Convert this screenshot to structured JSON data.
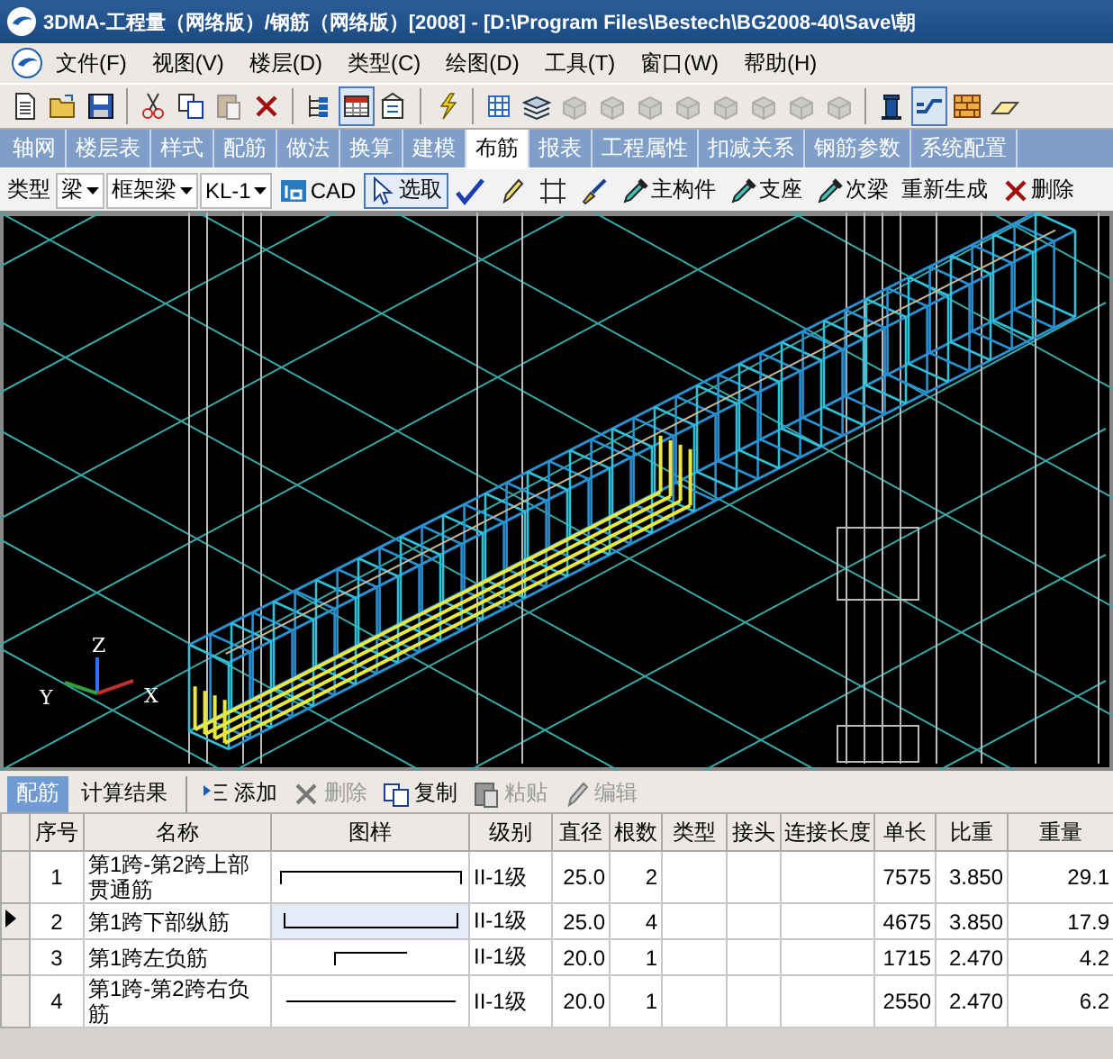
{
  "window": {
    "title": "3DMA-工程量（网络版）/钢筋（网络版）[2008] - [D:\\Program Files\\Bestech\\BG2008-40\\Save\\朝"
  },
  "menu": [
    "文件(F)",
    "视图(V)",
    "楼层(D)",
    "类型(C)",
    "绘图(D)",
    "工具(T)",
    "窗口(W)",
    "帮助(H)"
  ],
  "toolbar": [
    {
      "kind": "new",
      "disabled": false,
      "pressed": false
    },
    {
      "kind": "open",
      "disabled": false,
      "pressed": false
    },
    {
      "kind": "save",
      "disabled": false,
      "pressed": false
    },
    {
      "kind": "separator"
    },
    {
      "kind": "cut",
      "disabled": false,
      "pressed": false
    },
    {
      "kind": "copy",
      "disabled": false,
      "pressed": false
    },
    {
      "kind": "paste",
      "disabled": true,
      "pressed": false
    },
    {
      "kind": "delete",
      "disabled": false,
      "pressed": false
    },
    {
      "kind": "separator"
    },
    {
      "kind": "tree",
      "disabled": false,
      "pressed": false
    },
    {
      "kind": "table",
      "disabled": false,
      "pressed": true
    },
    {
      "kind": "form",
      "disabled": false,
      "pressed": false
    },
    {
      "kind": "separator"
    },
    {
      "kind": "lightning",
      "disabled": false,
      "pressed": false
    },
    {
      "kind": "separator"
    },
    {
      "kind": "grid",
      "disabled": false,
      "pressed": false
    },
    {
      "kind": "layers",
      "disabled": false,
      "pressed": false
    },
    {
      "kind": "block",
      "disabled": true,
      "pressed": false
    },
    {
      "kind": "block",
      "disabled": true,
      "pressed": false
    },
    {
      "kind": "block",
      "disabled": true,
      "pressed": false
    },
    {
      "kind": "block",
      "disabled": true,
      "pressed": false
    },
    {
      "kind": "block",
      "disabled": true,
      "pressed": false
    },
    {
      "kind": "block",
      "disabled": true,
      "pressed": false
    },
    {
      "kind": "block",
      "disabled": true,
      "pressed": false
    },
    {
      "kind": "block",
      "disabled": true,
      "pressed": false
    },
    {
      "kind": "separator"
    },
    {
      "kind": "column",
      "disabled": false,
      "pressed": false
    },
    {
      "kind": "bent-bar",
      "disabled": false,
      "pressed": true
    },
    {
      "kind": "brick",
      "disabled": false,
      "pressed": false
    },
    {
      "kind": "eraser",
      "disabled": false,
      "pressed": false
    }
  ],
  "tabs": [
    {
      "label": "轴网",
      "selected": false
    },
    {
      "label": "楼层表",
      "selected": false
    },
    {
      "label": "样式",
      "selected": false
    },
    {
      "label": "配筋",
      "selected": false
    },
    {
      "label": "做法",
      "selected": false
    },
    {
      "label": "换算",
      "selected": false
    },
    {
      "label": "建模",
      "selected": false
    },
    {
      "label": "布筋",
      "selected": true
    },
    {
      "label": "报表",
      "selected": false
    },
    {
      "label": "工程属性",
      "selected": false
    },
    {
      "label": "扣减关系",
      "selected": false
    },
    {
      "label": "钢筋参数",
      "selected": false
    },
    {
      "label": "系统配置",
      "selected": false
    }
  ],
  "edit_toolbar": [
    {
      "kind": "label",
      "text": "类型"
    },
    {
      "kind": "dropdown",
      "text": "梁"
    },
    {
      "kind": "dropdown",
      "text": "框架梁"
    },
    {
      "kind": "dropdown",
      "text": "KL-1"
    },
    {
      "kind": "cad",
      "text": "CAD",
      "pressed": false
    },
    {
      "kind": "pointer",
      "text": "选取",
      "pressed": true
    },
    {
      "kind": "check",
      "pressed": false
    },
    {
      "kind": "pen",
      "pressed": false
    },
    {
      "kind": "frame",
      "pressed": false
    },
    {
      "kind": "brush",
      "pressed": false
    },
    {
      "kind": "dropper",
      "text": "主构件",
      "pressed": false
    },
    {
      "kind": "dropper",
      "text": "支座",
      "pressed": false
    },
    {
      "kind": "dropper",
      "text": "次梁",
      "pressed": false
    },
    {
      "kind": "plain",
      "text": "重新生成",
      "pressed": false
    },
    {
      "kind": "delete",
      "text": "删除",
      "pressed": false
    }
  ],
  "view": {
    "axis_labels": [
      "Z",
      "Y",
      "X"
    ]
  },
  "panel_tabs": [
    {
      "label": "配筋",
      "selected": true
    },
    {
      "label": "计算结果",
      "selected": false
    }
  ],
  "panel_actions": [
    {
      "kind": "add",
      "label": "添加",
      "disabled": false
    },
    {
      "kind": "delete",
      "label": "删除",
      "disabled": true
    },
    {
      "kind": "copy",
      "label": "复制",
      "disabled": false
    },
    {
      "kind": "paste",
      "label": "粘贴",
      "disabled": true
    },
    {
      "kind": "edit",
      "label": "编辑",
      "disabled": true
    }
  ],
  "table": {
    "columns": [
      "序号",
      "名称",
      "图样",
      "级别",
      "直径",
      "根数",
      "类型",
      "接头",
      "连接长度",
      "单长",
      "比重",
      "重量"
    ],
    "rows": [
      {
        "index": "1",
        "name": "第1跨-第2跨上部贯通筋",
        "kind": "top-bar",
        "grade": "II-1级",
        "diameter": "25.0",
        "count": "2",
        "unit_length": "7575",
        "density": "3.850",
        "weight": "29.1",
        "selected": false
      },
      {
        "index": "2",
        "name": "第1跨下部纵筋",
        "kind": "bottom-bar",
        "grade": "II-1级",
        "diameter": "25.0",
        "count": "4",
        "unit_length": "4675",
        "density": "3.850",
        "weight": "17.9",
        "selected": true
      },
      {
        "index": "3",
        "name": "第1跨左负筋",
        "kind": "hook-bar",
        "grade": "II-1级",
        "diameter": "20.0",
        "count": "1",
        "unit_length": "1715",
        "density": "2.470",
        "weight": "4.2",
        "selected": false
      },
      {
        "index": "4",
        "name": "第1跨-第2跨右负筋",
        "kind": "straight-bar",
        "grade": "II-1级",
        "diameter": "20.0",
        "count": "1",
        "unit_length": "2550",
        "density": "2.470",
        "weight": "6.2",
        "selected": false
      }
    ]
  }
}
